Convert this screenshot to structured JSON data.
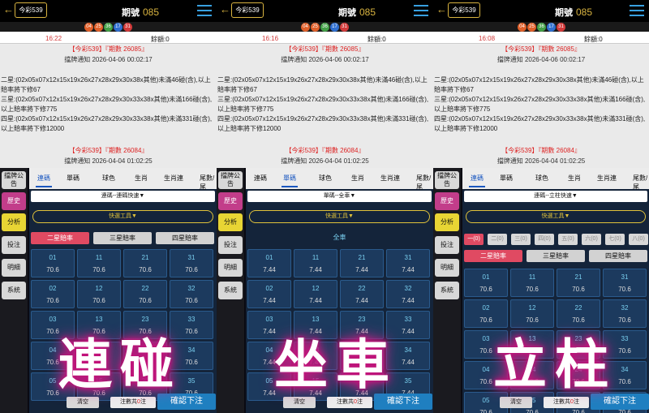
{
  "common": {
    "back": "←",
    "lottery": "今彩539",
    "period_label": "期號",
    "period_num": "085",
    "balls": [
      "04",
      "25",
      "36",
      "17",
      "31"
    ],
    "balance": "餘額:0",
    "notes": [
      {
        "title": "【今彩539】『期數 26085』",
        "sub": "擋牌通知 2026-04-06 00:02:17",
        "body": "二星:(02x05x07x12x15x19x26x27x28x29x30x38x其他)未滿46碰(含),以上賠率將下修67\n三星:(02x05x07x12x15x19x26x27x28x29x30x33x38x其他)未滿166碰(含),以上賠率將下修775\n四星:(02x05x07x12x15x19x26x27x28x29x30x33x38x其他)未滿331碰(含),以上賠率將下修12000"
      },
      {
        "title": "【今彩539】『期數 26084』",
        "sub": "擋牌通知 2026-04-04 01:02:25"
      }
    ],
    "sidebar": [
      "擋牌公告",
      "歷史",
      "分析",
      "投注",
      "明細",
      "系統"
    ],
    "tabs": [
      "連碼",
      "單碼",
      "球色",
      "生肖",
      "生肖連",
      "尾數/尾"
    ],
    "quick": "快選工具▼",
    "rates": [
      "二星賠率",
      "三星賠率",
      "四星賠率"
    ],
    "clear": "清空",
    "count_label": "注數共",
    "count_val": "0",
    "count_unit": "注",
    "confirm": "確認下注"
  },
  "panels": [
    {
      "time": "16:22",
      "active_tab": 0,
      "select": "連碼--連碼快速▼",
      "odds": "70.6",
      "numbers": [
        "01",
        "11",
        "21",
        "31",
        "02",
        "12",
        "22",
        "32",
        "03",
        "13",
        "23",
        "33",
        "04",
        "14",
        "24",
        "34",
        "05",
        "15",
        "25",
        "35"
      ],
      "overlay": "連碰"
    },
    {
      "time": "16:16",
      "active_tab": 1,
      "select": "單碼--全車▼",
      "all_car": "全車",
      "odds": "7.44",
      "numbers": [
        "01",
        "11",
        "21",
        "31",
        "02",
        "12",
        "22",
        "32",
        "03",
        "13",
        "23",
        "33",
        "04",
        "14",
        "24",
        "34",
        "05",
        "15",
        "25",
        "35"
      ],
      "overlay": "坐車"
    },
    {
      "time": "16:08",
      "active_tab": 0,
      "select": "連碼--立柱快速▼",
      "pillars": [
        "一(0)",
        "二(0)",
        "三(0)",
        "四(0)",
        "五(0)",
        "六(0)",
        "七(0)",
        "八(0)"
      ],
      "odds": "70.6",
      "numbers": [
        "01",
        "11",
        "21",
        "31",
        "02",
        "12",
        "22",
        "32",
        "03",
        "13",
        "23",
        "33",
        "04",
        "14",
        "24",
        "34",
        "05",
        "15",
        "25",
        "35"
      ],
      "overlay": "立柱"
    }
  ]
}
